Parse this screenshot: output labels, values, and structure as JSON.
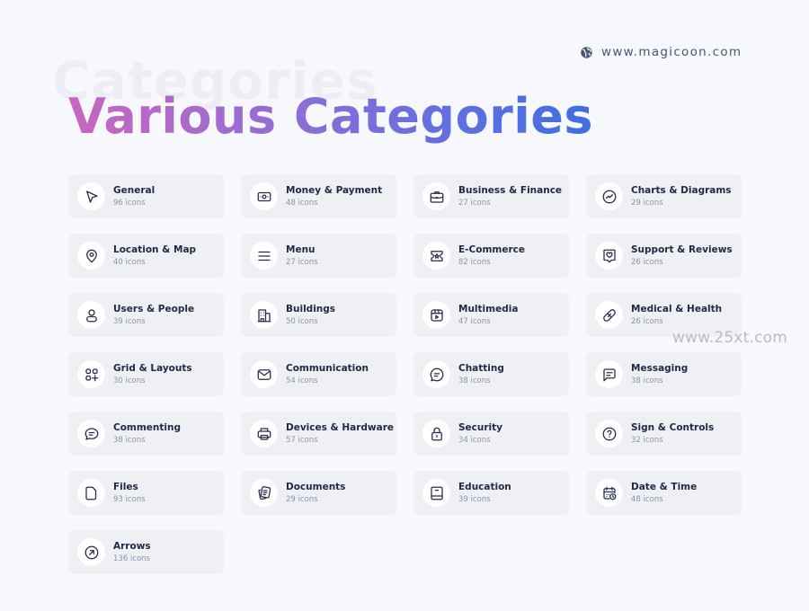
{
  "header": {
    "website": "www.magicoon.com",
    "website_icon": "globe-icon",
    "background_title": "Categories",
    "title": "Various Categories"
  },
  "watermark": "www.25xt.com",
  "categories": [
    {
      "name": "General",
      "count": "96 icons",
      "icon": "cursor-pointer-icon"
    },
    {
      "name": "Money & Payment",
      "count": "48 icons",
      "icon": "banknote-icon"
    },
    {
      "name": "Business & Finance",
      "count": "27 icons",
      "icon": "briefcase-icon"
    },
    {
      "name": "Charts & Diagrams",
      "count": "29 icons",
      "icon": "chart-circle-icon"
    },
    {
      "name": "Location & Map",
      "count": "40 icons",
      "icon": "location-pin-icon"
    },
    {
      "name": "Menu",
      "count": "27  icons",
      "icon": "menu-icon"
    },
    {
      "name": "E-Commerce",
      "count": "82  icons",
      "icon": "ticket-star-icon"
    },
    {
      "name": "Support & Reviews",
      "count": "26 icons",
      "icon": "heart-message-icon"
    },
    {
      "name": "Users & People",
      "count": "39 icons",
      "icon": "user-icon"
    },
    {
      "name": "Buildings",
      "count": "50 icons",
      "icon": "building-icon"
    },
    {
      "name": "Multimedia",
      "count": "47 icons",
      "icon": "video-play-icon"
    },
    {
      "name": "Medical & Health",
      "count": "26 icons",
      "icon": "bandage-icon"
    },
    {
      "name": "Grid & Layouts",
      "count": "30 icons",
      "icon": "grid-add-icon"
    },
    {
      "name": "Communication",
      "count": "54 icons",
      "icon": "mail-icon"
    },
    {
      "name": "Chatting",
      "count": "38 icons",
      "icon": "chat-bubble-icon"
    },
    {
      "name": "Messaging",
      "count": "38 icons",
      "icon": "message-square-icon"
    },
    {
      "name": "Commenting",
      "count": "38 icons",
      "icon": "comment-icon"
    },
    {
      "name": "Devices & Hardware",
      "count": "57 icons",
      "icon": "printer-icon"
    },
    {
      "name": "Security",
      "count": "34 icons",
      "icon": "lock-icon"
    },
    {
      "name": "Sign & Controls",
      "count": "32 icons",
      "icon": "question-circle-icon"
    },
    {
      "name": "Files",
      "count": "93 icons",
      "icon": "file-icon"
    },
    {
      "name": "Documents",
      "count": "29 icons",
      "icon": "documents-icon"
    },
    {
      "name": "Education",
      "count": "39 icons",
      "icon": "book-icon"
    },
    {
      "name": "Date & Time",
      "count": "48 icons",
      "icon": "calendar-clock-icon"
    },
    {
      "name": "Arrows",
      "count": "136 icons",
      "icon": "arrow-up-right-circle-icon"
    }
  ]
}
